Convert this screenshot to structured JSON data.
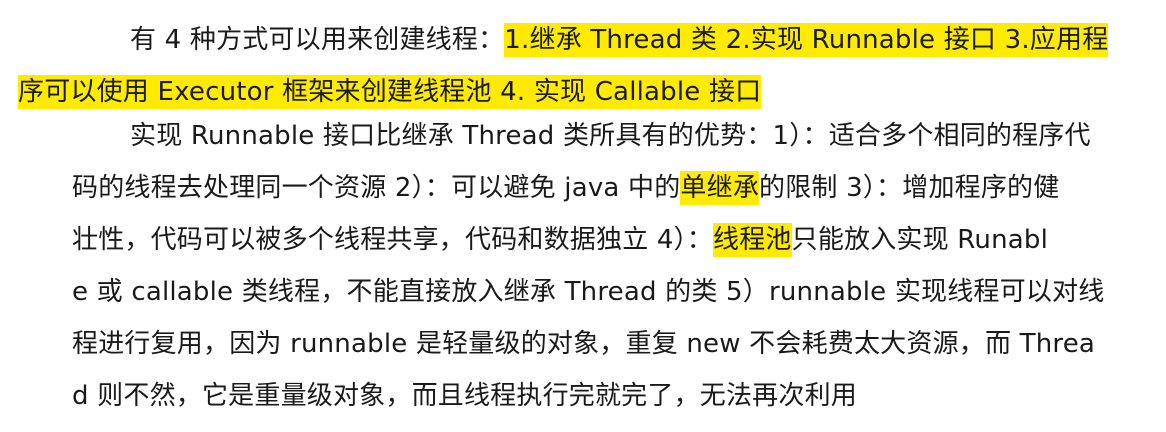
{
  "paragraph1": {
    "line1_plain": "有 4 种方式可以用来创建线程：",
    "line1_highlight": "1.继承 Thread 类 2.实现 Runnable 接口 3.应用程",
    "line2_highlight": "序可以使用 Executor 框架来创建线程池 4.  实现 Callable 接口"
  },
  "paragraph2": {
    "line1": "实现 Runnable 接口比继承 Thread 类所具有的优势：1）：适合多个相同的程序代",
    "line2_before": "码的线程去处理同一个资源 2）：可以避免 java 中的",
    "line2_highlight": "单继承",
    "line2_after": "的限制 3）：增加程序的健",
    "line3_before": "壮性，代码可以被多个线程共享，代码和数据独立 4）：",
    "line3_highlight": "线程池",
    "line3_after": "只能放入实现 Runabl",
    "line4": "e 或 callable 类线程，不能直接放入继承 Thread 的类 5）runnable 实现线程可以对线",
    "line5": "程进行复用，因为 runnable 是轻量级的对象，重复 new 不会耗费太大资源，而 Threa",
    "line6": "d 则不然，它是重量级对象，而且线程执行完就完了，无法再次利用"
  },
  "colors": {
    "highlight": "#ffeb00",
    "text": "#1a1a1a",
    "background": "#ffffff"
  }
}
